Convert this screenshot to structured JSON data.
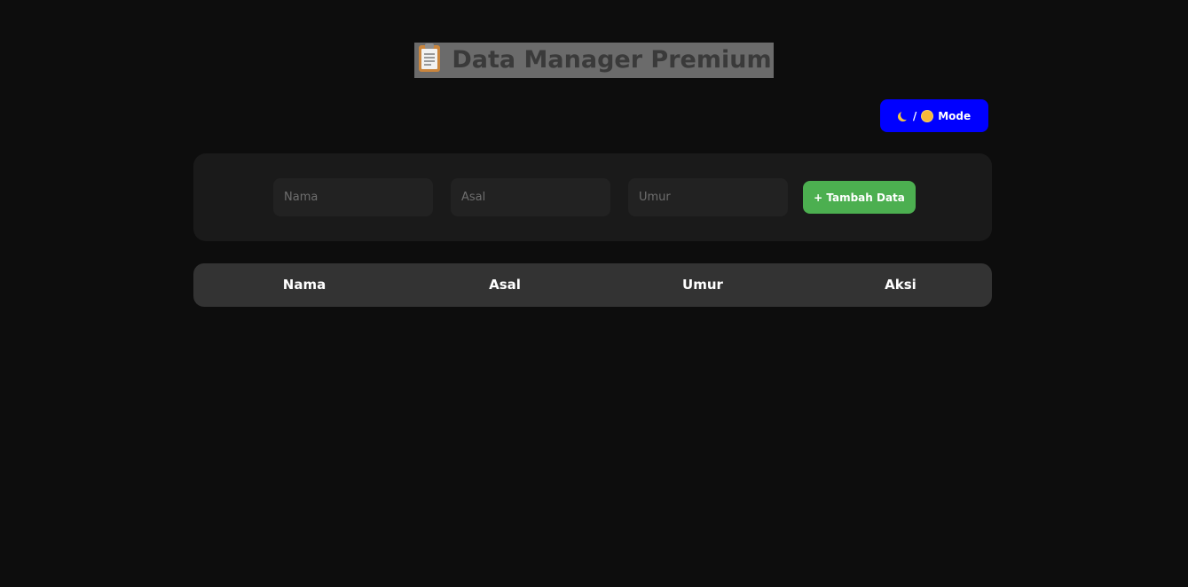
{
  "header": {
    "title": "Data Manager Premium",
    "title_icon": "clipboard-icon"
  },
  "mode_toggle": {
    "label_separator": "/",
    "label_text": "Mode",
    "icons": [
      "moon-icon",
      "sun-icon"
    ],
    "color": "#0000ff"
  },
  "form": {
    "nama_placeholder": "Nama",
    "asal_placeholder": "Asal",
    "umur_placeholder": "Umur",
    "nama_value": "",
    "asal_value": "",
    "umur_value": "",
    "add_label": "+ Tambah Data",
    "add_color": "#4caf50"
  },
  "table": {
    "columns": [
      "Nama",
      "Asal",
      "Umur",
      "Aksi"
    ],
    "rows": []
  },
  "colors": {
    "background": "#0d0d0d",
    "card": "#1a1a1a",
    "table_header": "#333333"
  }
}
